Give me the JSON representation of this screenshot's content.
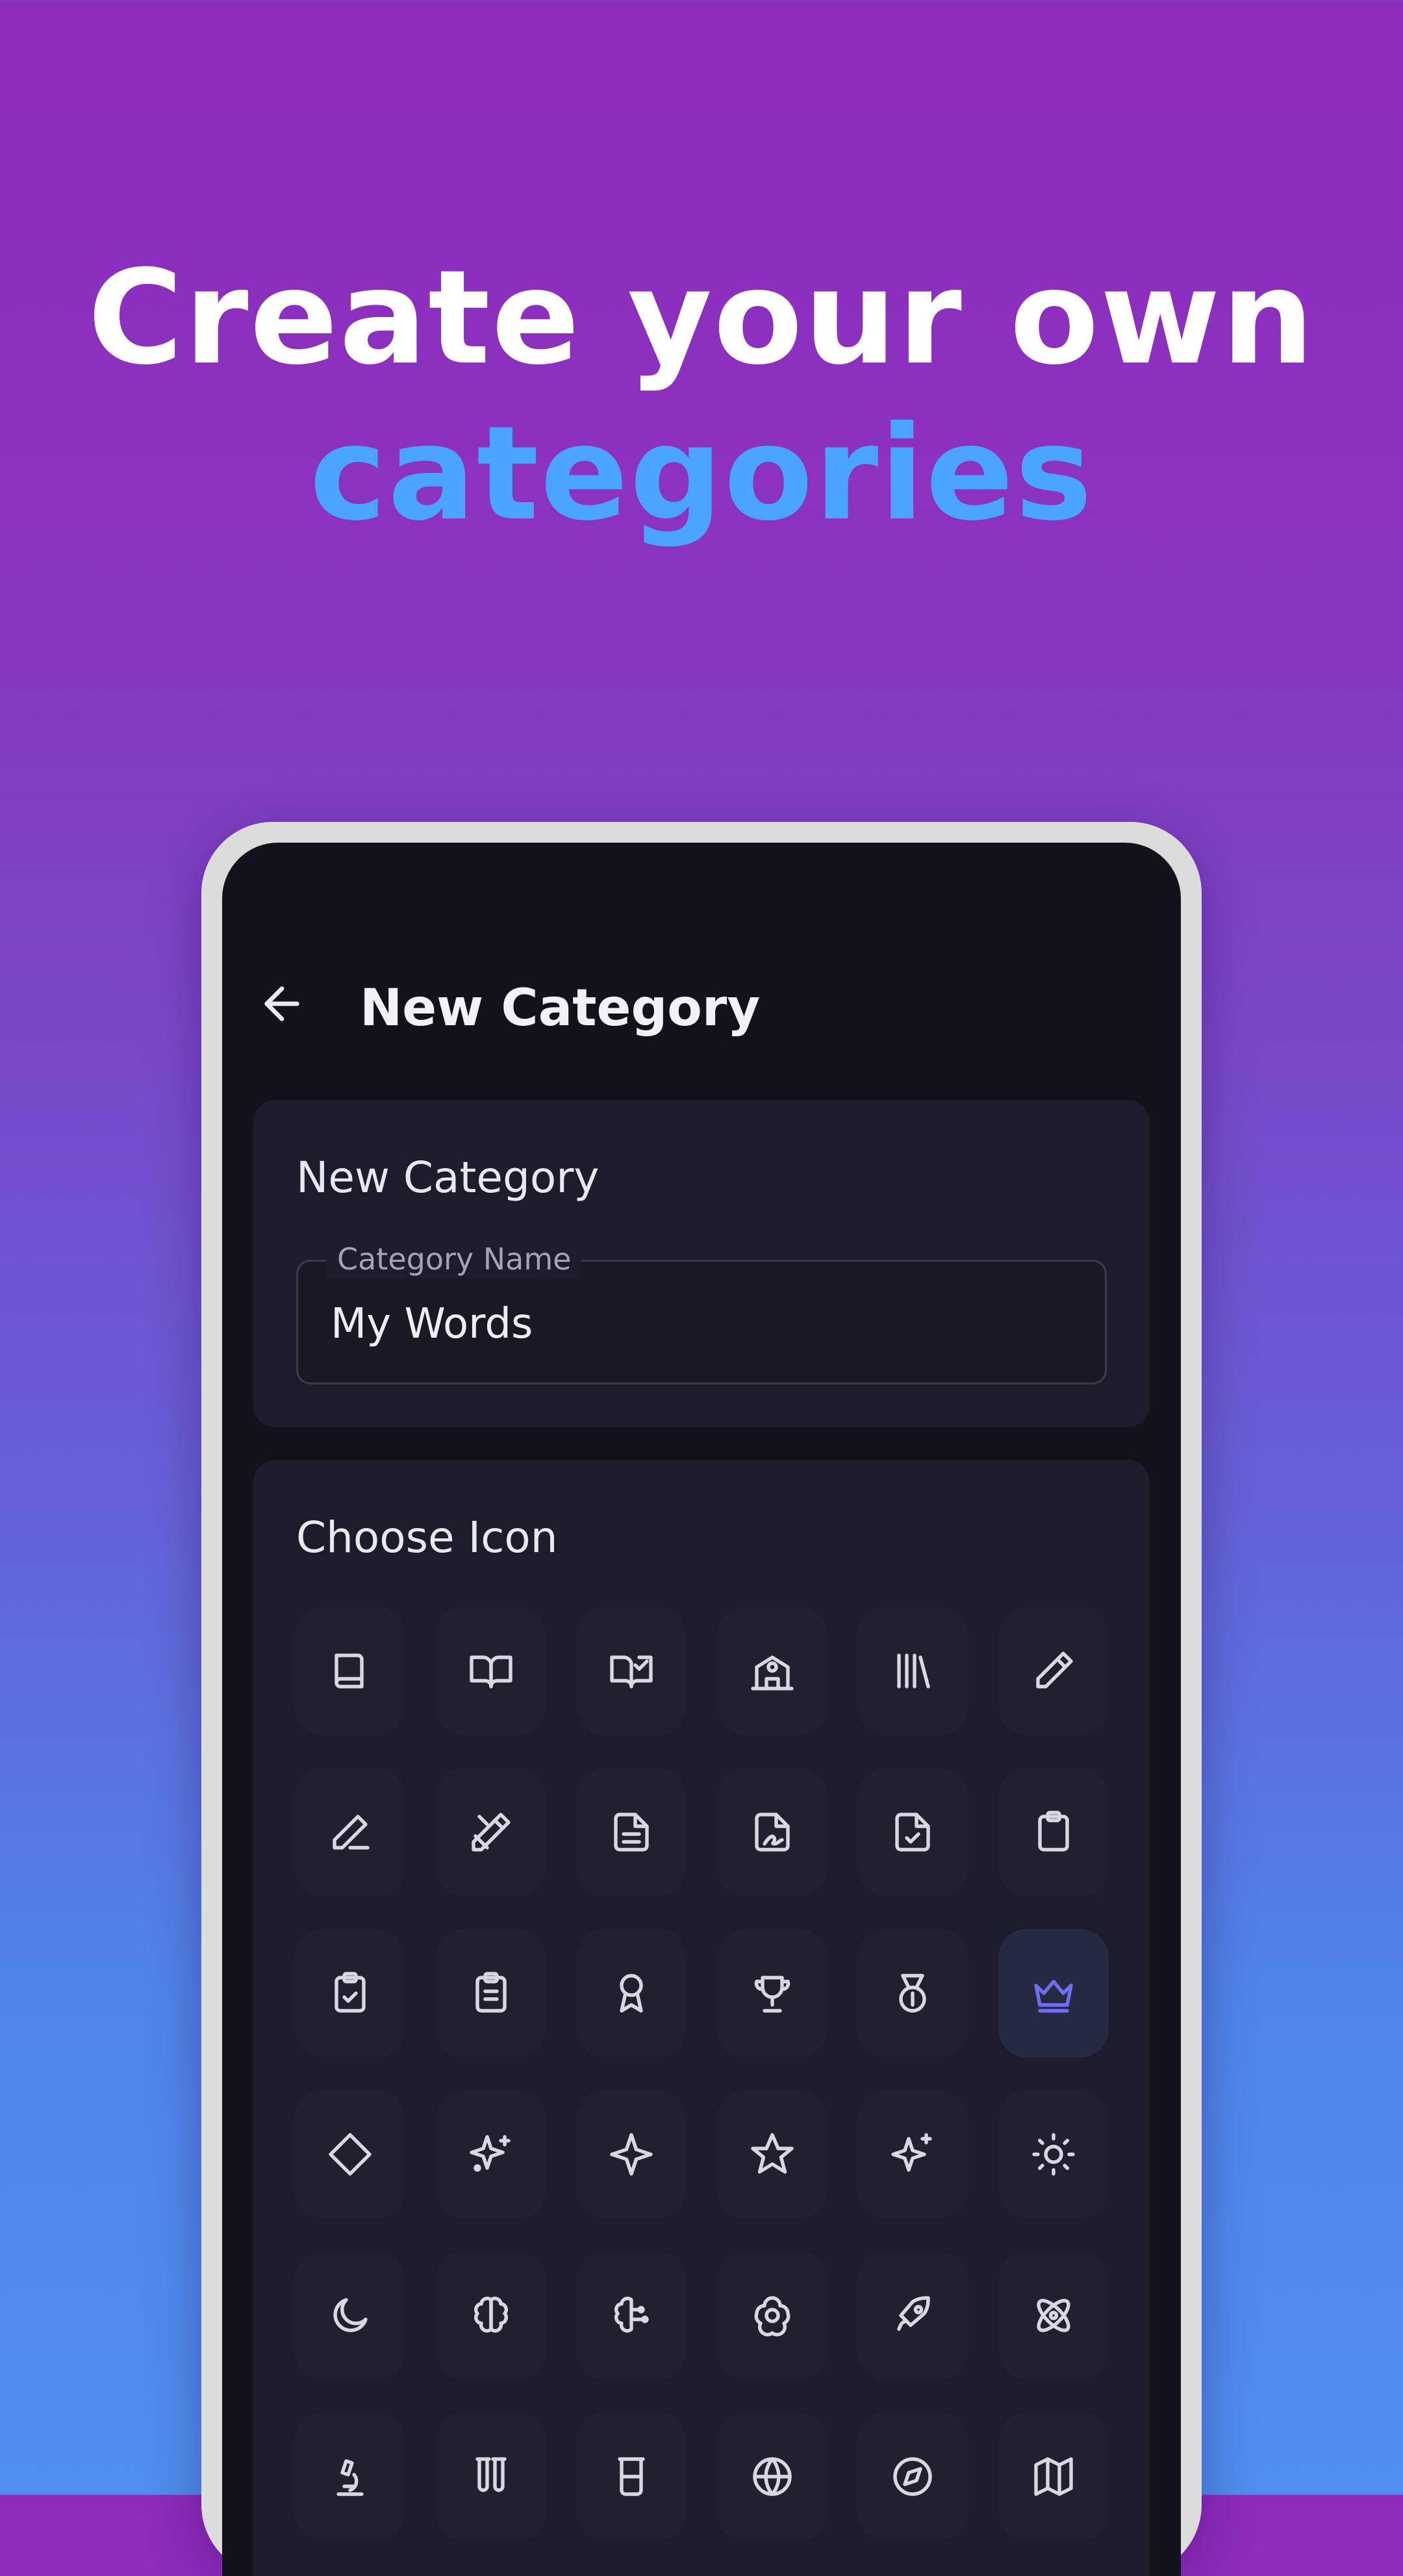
{
  "headline": {
    "line1": "Create your own",
    "line2": "categories"
  },
  "appbar": {
    "title": "New Category",
    "back_icon": "arrow-left-icon"
  },
  "name_card": {
    "title": "New Category",
    "field_label": "Category Name",
    "field_value": "My Words"
  },
  "icon_card": {
    "title": "Choose Icon",
    "selected_icon": "crown-icon",
    "icons": [
      "book-icon",
      "book-open-icon",
      "book-open-check-icon",
      "school-icon",
      "library-icon",
      "pencil-icon",
      "pen-line-icon",
      "pencil-ruler-icon",
      "file-text-icon",
      "file-signature-icon",
      "file-check-icon",
      "clipboard-icon",
      "clipboard-check-icon",
      "clipboard-list-icon",
      "award-icon",
      "trophy-icon",
      "medal-icon",
      "crown-icon",
      "diamond-icon",
      "sparkles-icon",
      "sparkle-icon",
      "star-icon",
      "sparkles-alt-icon",
      "sun-icon",
      "moon-icon",
      "brain-icon",
      "brain-circuit-icon",
      "atom-flower-icon",
      "rocket-icon",
      "atom-icon",
      "microscope-icon",
      "test-tubes-icon",
      "beaker-icon",
      "globe-icon",
      "compass-icon",
      "map-icon"
    ]
  },
  "colors": {
    "accent_text": "#4aa3ff",
    "selected_icon": "#6f6ff2",
    "icon_stroke": "#d8d8e0"
  }
}
